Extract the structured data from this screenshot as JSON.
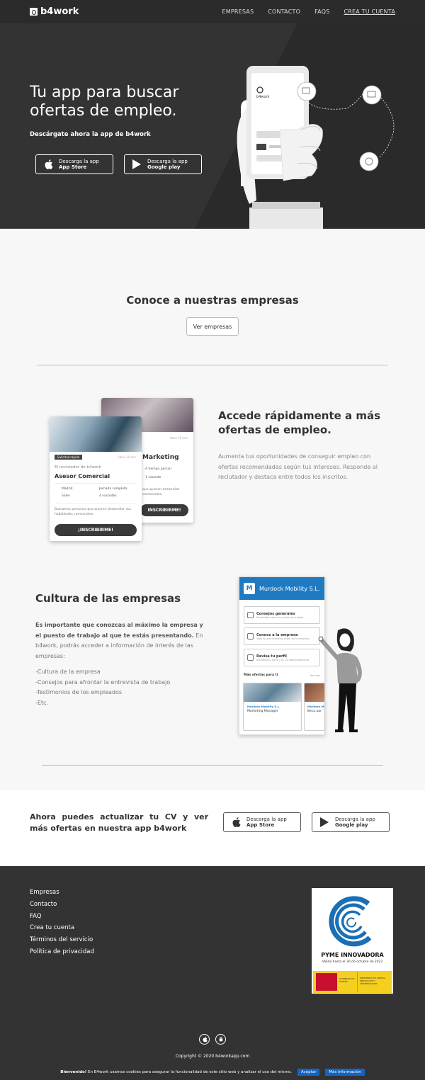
{
  "header": {
    "logo_text": "b4work",
    "nav": [
      "EMPRESAS",
      "CONTACTO",
      "FAQS",
      "CREA TU CUENTA"
    ]
  },
  "hero": {
    "title": "Tu app para buscar ofertas de empleo.",
    "subtitle": "Descárgate ahora la app de b4work",
    "phone_logo": "b4work",
    "app_store": {
      "line1": "Descarga la app",
      "line2": "App Store"
    },
    "google_play": {
      "line1": "Descarga la app",
      "line2": "Google play"
    }
  },
  "companies": {
    "title": "Conoce a nuestras empresas",
    "button": "Ver empresas"
  },
  "feature1": {
    "title": "Accede rápidamente a más ofertas de empleo.",
    "text": "Aumenta tus oportunidades de conseguir empleo con ofertas recomendadas según tus intereses. Responde al reclutador y destaca entre todos los inscritos.",
    "card_front": {
      "tag": "Solicitud rápida",
      "time": "Hace 10 min",
      "recruiter": "El reclutador de b4work",
      "job": "Asesor Comercial",
      "meta": [
        "Madrid",
        "Jornada completa",
        "Sales",
        "4 vacantes"
      ],
      "desc": "Buscamos personas que quieran desarrollar sus habilidades comerciales.",
      "button": "¡INSCRIBIRME!"
    },
    "card_back": {
      "time": "Hace 10 min",
      "job": "Marketing",
      "meta": [
        "A tiempo parcial",
        "1 vacante"
      ],
      "desc": "que quieran desarrollar comerciales.",
      "button": "INSCRIBIRME!"
    }
  },
  "feature2": {
    "title": "Cultura de las empresas",
    "text_bold": "Es importante que conozcas al máximo la empresa y el puesto de trabajo al que te estás presentando.",
    "text_rest": " En b4work, podrás acceder a información de interés de las empresas:",
    "list": [
      "-Cultura de la empresa",
      "-Consejos para afrontar la entrevista de trabajo",
      "-Testimonios de los empleados",
      "-Etc."
    ],
    "phone": {
      "company": "Murdock Mobility S.L.",
      "items": [
        {
          "title": "Consejos generales",
          "sub": "Preséntate sobre tu puesto de trabajo"
        },
        {
          "title": "Conoce a la empresa",
          "sub": "Todo lo que necesitas saber de la empresa"
        },
        {
          "title": "Revisa tu perfil",
          "sub": "Actualiza tu perfil y tu CV adecuadamente"
        }
      ],
      "more": "Más ofertas para ti",
      "see_all": "Ver más",
      "offers": [
        {
          "company": "Murdock Mobility S.L.",
          "job": "Marketing Manager"
        },
        {
          "company": "Murdock Mo",
          "job": "Beca par"
        }
      ]
    }
  },
  "cta": {
    "text": "Ahora puedes actualizar tu CV y ver más ofertas en nuestra app b4work",
    "app_store": {
      "line1": "Descarga la app",
      "line2": "App Store"
    },
    "google_play": {
      "line1": "Descarga la app",
      "line2": "Google play"
    }
  },
  "footer": {
    "links": [
      "Empresas",
      "Contacto",
      "FAQ",
      "Crea tu cuenta",
      "Términos del servicio",
      "Política de privacidad"
    ],
    "badge_title": "PYME INNOVADORA",
    "badge_valid": "Válido hasta el 30 de octubre de 2022",
    "badge_gov_left": "GOBIERNO DE ESPAÑA",
    "badge_gov_right": "MINISTERIO DE CIENCIA, INNOVACIÓN Y UNIVERSIDADES",
    "copyright": "Copyright © 2020 b4workapp.com"
  },
  "cookie": {
    "bold": "Bienvenido!",
    "text": " En B4work usamos cookies para asegurar la funcionalidad de este sitio web y analizar el uso del mismo.",
    "accept": "Aceptar",
    "more": "Más información"
  },
  "colors": {
    "dark": "#333333",
    "accent": "#1f7ac2",
    "cookie_btn": "#1565c0"
  }
}
